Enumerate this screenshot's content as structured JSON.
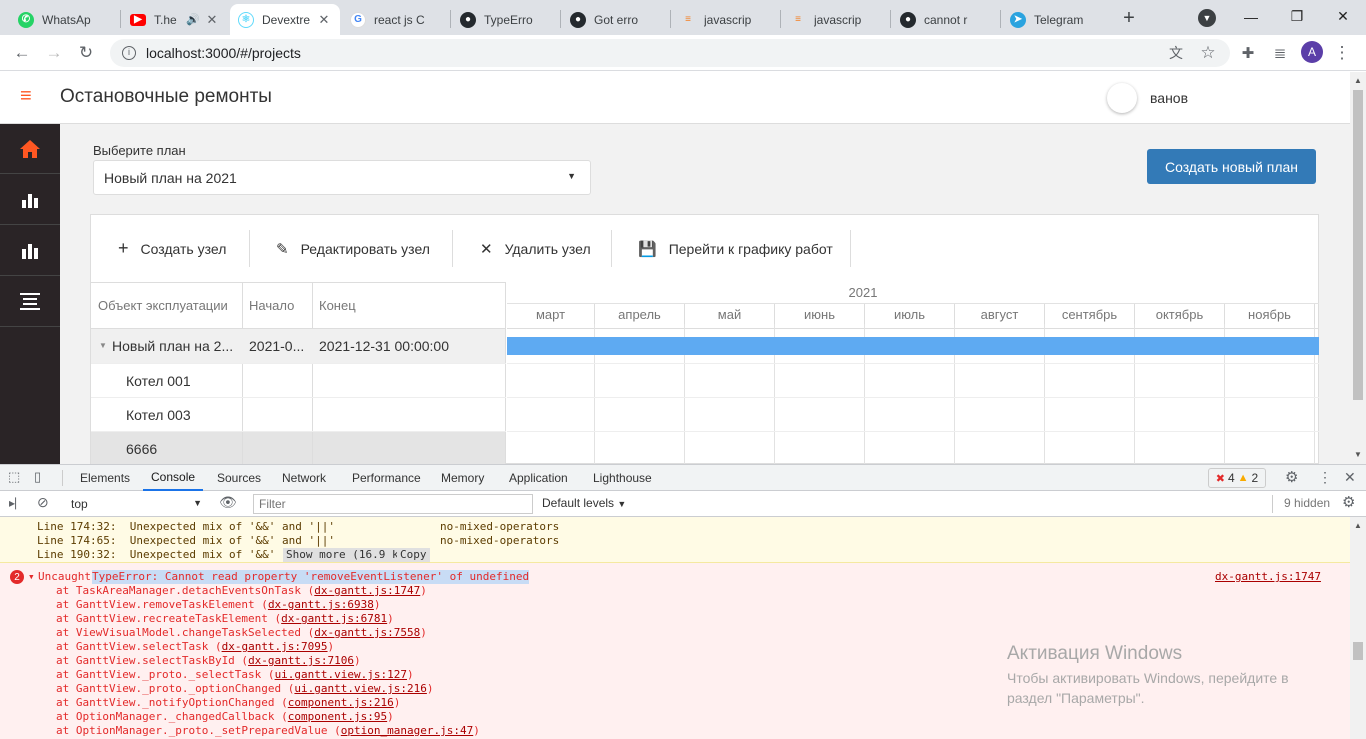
{
  "browser": {
    "tabs": [
      {
        "title": "WhatsAp",
        "icon": "whatsapp-icon",
        "color": "#25d366"
      },
      {
        "title": "T.he",
        "icon": "youtube-icon",
        "color": "#ff0000"
      },
      {
        "title": "Devextre",
        "icon": "react-icon",
        "color": "#61dafb"
      },
      {
        "title": "react js C",
        "icon": "google-icon",
        "color": "#4285f4"
      },
      {
        "title": "TypeErro",
        "icon": "github-icon",
        "color": "#24292e"
      },
      {
        "title": "Got erro",
        "icon": "github-icon",
        "color": "#24292e"
      },
      {
        "title": "javascrip",
        "icon": "stackoverflow-icon",
        "color": "#f48024"
      },
      {
        "title": "javascrip",
        "icon": "stackoverflow-icon",
        "color": "#f48024"
      },
      {
        "title": "cannot r",
        "icon": "github-icon",
        "color": "#24292e"
      },
      {
        "title": "Telegram",
        "icon": "telegram-icon",
        "color": "#2aa3df"
      }
    ],
    "new_tab": "+",
    "url": "localhost:3000/#/projects",
    "profile_initial": "A"
  },
  "app": {
    "title": "Остановочные ремонты",
    "user_name": "ванов",
    "plan_label": "Выберите план",
    "plan_value": "Новый план на 2021",
    "create_plan_button": "Создать новый план",
    "toolbar": {
      "create_node": "Создать узел",
      "edit_node": "Редактировать узел",
      "delete_node": "Удалить узел",
      "go_schedule": "Перейти к графику работ"
    },
    "gantt": {
      "columns": [
        "Объект эксплуатации",
        "Начало",
        "Конец"
      ],
      "year": "2021",
      "months": [
        "март",
        "апрель",
        "май",
        "июнь",
        "июль",
        "август",
        "сентябрь",
        "октябрь",
        "ноябрь"
      ],
      "rows": [
        {
          "name": "Новый план на 2...",
          "start": "2021-0...",
          "end": "2021-12-31 00:00:00",
          "expandable": true
        },
        {
          "name": "Котел 001",
          "start": "",
          "end": ""
        },
        {
          "name": "Котел 003",
          "start": "",
          "end": ""
        },
        {
          "name": "6666",
          "start": "",
          "end": ""
        }
      ]
    }
  },
  "devtools": {
    "tabs": [
      "Elements",
      "Console",
      "Sources",
      "Network",
      "Performance",
      "Memory",
      "Application",
      "Lighthouse"
    ],
    "active_tab": "Console",
    "error_count": "4",
    "warn_count": "2",
    "context": "top",
    "filter_placeholder": "Filter",
    "levels": "Default levels",
    "hidden": "9 hidden",
    "warnings": [
      {
        "text": "Line 174:32:  Unexpected mix of '&&' and '||'",
        "rule": "no-mixed-operators"
      },
      {
        "text": "Line 174:65:  Unexpected mix of '&&' and '||'",
        "rule": "no-mixed-operators"
      },
      {
        "text": "Line 190:32:  Unexpected mix of '&&'"
      }
    ],
    "show_more": "Show more (16.9 kB)",
    "copy": "Copy",
    "error_badge": "2",
    "error_prefix": "Uncaught",
    "error_message": "TypeError: Cannot read property 'removeEventListener' of undefined",
    "error_source": "dx-gantt.js:1747",
    "stack": [
      {
        "fn": "at TaskAreaManager.detachEventsOnTask",
        "loc": "dx-gantt.js:1747"
      },
      {
        "fn": "at GanttView.removeTaskElement",
        "loc": "dx-gantt.js:6938"
      },
      {
        "fn": "at GanttView.recreateTaskElement",
        "loc": "dx-gantt.js:6781"
      },
      {
        "fn": "at ViewVisualModel.changeTaskSelected",
        "loc": "dx-gantt.js:7558"
      },
      {
        "fn": "at GanttView.selectTask",
        "loc": "dx-gantt.js:7095"
      },
      {
        "fn": "at GanttView.selectTaskById",
        "loc": "dx-gantt.js:7106"
      },
      {
        "fn": "at GanttView._proto._selectTask",
        "loc": "ui.gantt.view.js:127"
      },
      {
        "fn": "at GanttView._proto._optionChanged",
        "loc": "ui.gantt.view.js:216"
      },
      {
        "fn": "at GanttView._notifyOptionChanged",
        "loc": "component.js:216"
      },
      {
        "fn": "at OptionManager._changedCallback",
        "loc": "component.js:95"
      },
      {
        "fn": "at OptionManager._proto._setPreparedValue",
        "loc": "option_manager.js:47"
      }
    ]
  },
  "watermark": {
    "title": "Активация Windows",
    "line1": "Чтобы активировать Windows, перейдите в",
    "line2": "раздел \"Параметры\"."
  }
}
